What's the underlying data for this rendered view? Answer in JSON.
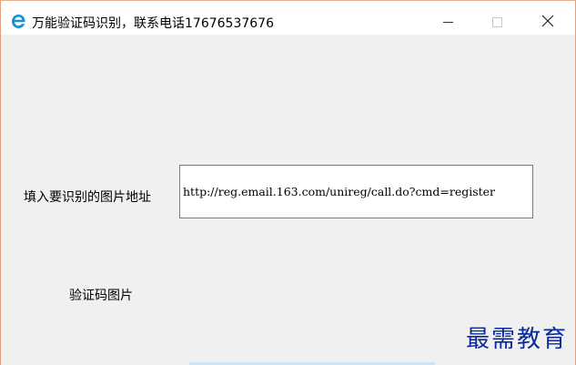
{
  "window": {
    "title": "万能验证码识别，联系电话17676537676",
    "icon": "ie-logo-icon",
    "accent_color": "#1e90d6",
    "controls": {
      "minimize": "minimize-icon",
      "maximize": "maximize-icon",
      "close": "close-icon"
    }
  },
  "form": {
    "url_label": "填入要识别的图片地址",
    "url_value": "http://reg.email.163.com/unireg/call.do?cmd=register",
    "captcha_label": "验证码图片"
  },
  "watermark": {
    "text": "最需教育",
    "color": "#0a2a9a"
  }
}
